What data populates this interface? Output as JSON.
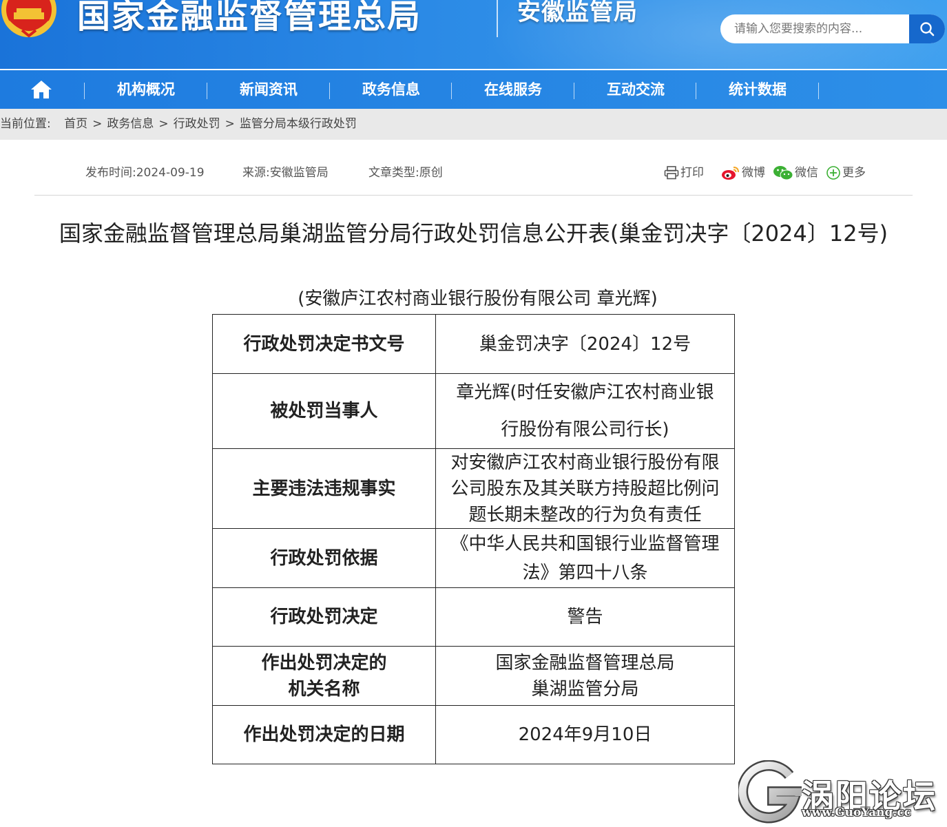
{
  "header": {
    "site_title": "国家金融监督管理总局",
    "sub_title": "安徽监管局",
    "search_placeholder": "请输入您要搜索的内容..."
  },
  "nav": {
    "items": [
      "机构概况",
      "新闻资讯",
      "政务信息",
      "在线服务",
      "互动交流",
      "统计数据"
    ]
  },
  "breadcrumb": {
    "label": "当前位置:",
    "items": [
      "首页",
      "政务信息",
      "行政处罚",
      "监管分局本级行政处罚"
    ],
    "separator": ">"
  },
  "meta": {
    "publish": "发布时间:2024-09-19",
    "source": "来源:安徽监管局",
    "type": "文章类型:原创"
  },
  "share": {
    "print": "打印",
    "weibo": "微博",
    "wechat": "微信",
    "more": "更多"
  },
  "article": {
    "title": "国家金融监督管理总局巢湖监管分局行政处罚信息公开表(巢金罚决字〔2024〕12号)",
    "subject": "(安徽庐江农村商业银行股份有限公司 章光辉)",
    "rows": [
      {
        "label": [
          "行政处罚决定书文号"
        ],
        "value": [
          "巢金罚决字〔2024〕12号"
        ]
      },
      {
        "label": [
          "被处罚当事人"
        ],
        "value": [
          "章光辉(时任安徽庐江农村商业银",
          "行股份有限公司行长)"
        ]
      },
      {
        "label": [
          "主要违法违规事实"
        ],
        "value": [
          "对安徽庐江农村商业银行股份有限",
          "公司股东及其关联方持股超比例问",
          "题长期未整改的行为负有责任"
        ]
      },
      {
        "label": [
          "行政处罚依据"
        ],
        "value": [
          "《中华人民共和国银行业监督管理",
          "法》第四十八条"
        ]
      },
      {
        "label": [
          "行政处罚决定"
        ],
        "value": [
          "警告"
        ]
      },
      {
        "label": [
          "作出处罚决定的",
          "机关名称"
        ],
        "value": [
          "国家金融监督管理总局",
          "巢湖监管分局"
        ]
      },
      {
        "label": [
          "作出处罚决定的日期"
        ],
        "value": [
          "2024年9月10日"
        ]
      }
    ]
  },
  "watermark": {
    "text": "涡阳论坛",
    "url": "www.GuoYang.cc"
  },
  "colors": {
    "header_blue": "#1a73d9",
    "nav_blue": "#2d8fe8",
    "breadcrumb_bg": "#e9e9e9",
    "emblem_red": "#d8231c",
    "emblem_gold": "#f3c234"
  },
  "icons": [
    "national-emblem-icon",
    "search-icon",
    "home-icon",
    "print-icon",
    "weibo-icon",
    "wechat-icon",
    "plus-circle-icon",
    "watermark-logo-icon"
  ]
}
